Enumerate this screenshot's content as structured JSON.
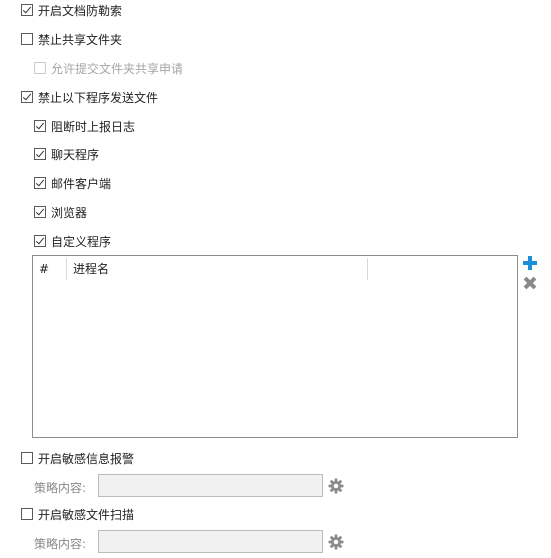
{
  "options": {
    "doc_ransomware": {
      "label": "开启文档防勒索",
      "checked": true
    },
    "disable_shared_folder": {
      "label": "禁止共享文件夹",
      "checked": false
    },
    "allow_submit_shared_request": {
      "label": "允许提交文件夹共享申请",
      "checked": false,
      "disabled": true
    },
    "block_programs": {
      "label": "禁止以下程序发送文件",
      "checked": true
    },
    "report_log": {
      "label": "阻断时上报日志",
      "checked": true
    },
    "chat_programs": {
      "label": "聊天程序",
      "checked": true
    },
    "mail_clients": {
      "label": "邮件客户端",
      "checked": true
    },
    "browsers": {
      "label": "浏览器",
      "checked": true
    },
    "custom_programs": {
      "label": "自定义程序",
      "checked": true
    }
  },
  "process_table": {
    "columns": [
      "#",
      "进程名"
    ],
    "rows": []
  },
  "icons": {
    "add": "plus-icon",
    "remove": "close-icon",
    "settings": "gear-icon",
    "accent": "#1b8fd8"
  },
  "sensitive_alert": {
    "label": "开启敏感信息报警",
    "checked": false,
    "policy_label": "策略内容:",
    "policy_value": ""
  },
  "sensitive_scan": {
    "label": "开启敏感文件扫描",
    "checked": false,
    "policy_label": "策略内容:",
    "policy_value": ""
  }
}
